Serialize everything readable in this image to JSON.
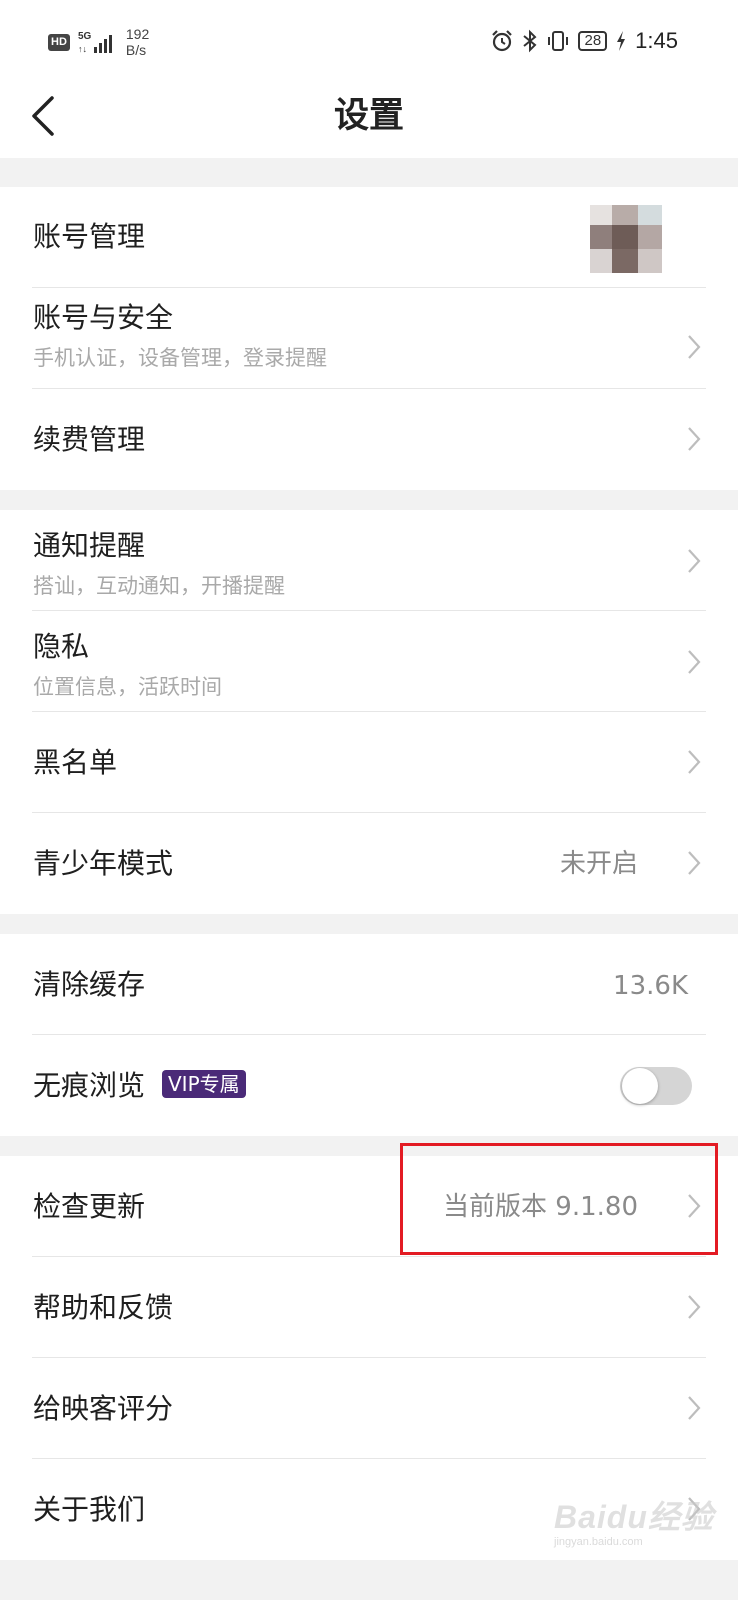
{
  "status_bar": {
    "hd": "HD",
    "net_type": "5G",
    "speed_value": "192",
    "speed_unit": "B/s",
    "battery": "28",
    "time": "1:45"
  },
  "header": {
    "title": "设置"
  },
  "groups": [
    {
      "items": [
        {
          "title": "账号管理"
        },
        {
          "title": "账号与安全",
          "subtitle": "手机认证，设备管理，登录提醒"
        },
        {
          "title": "续费管理"
        }
      ]
    },
    {
      "items": [
        {
          "title": "通知提醒",
          "subtitle": "搭讪，互动通知，开播提醒"
        },
        {
          "title": "隐私",
          "subtitle": "位置信息，活跃时间"
        },
        {
          "title": "黑名单"
        },
        {
          "title": "青少年模式",
          "value": "未开启"
        }
      ]
    },
    {
      "items": [
        {
          "title": "清除缓存",
          "value": "13.6K"
        },
        {
          "title": "无痕浏览",
          "badge": "VIP专属",
          "toggle_on": false
        }
      ]
    },
    {
      "items": [
        {
          "title": "检查更新",
          "value": "当前版本 9.1.80"
        },
        {
          "title": "帮助和反馈"
        },
        {
          "title": "给映客评分"
        },
        {
          "title": "关于我们"
        }
      ]
    }
  ],
  "watermark": {
    "text": "Baidu经验",
    "sub": "jingyan.baidu.com"
  },
  "colors": {
    "highlight": "#e31b23",
    "vip_badge": "#4a2a78"
  }
}
